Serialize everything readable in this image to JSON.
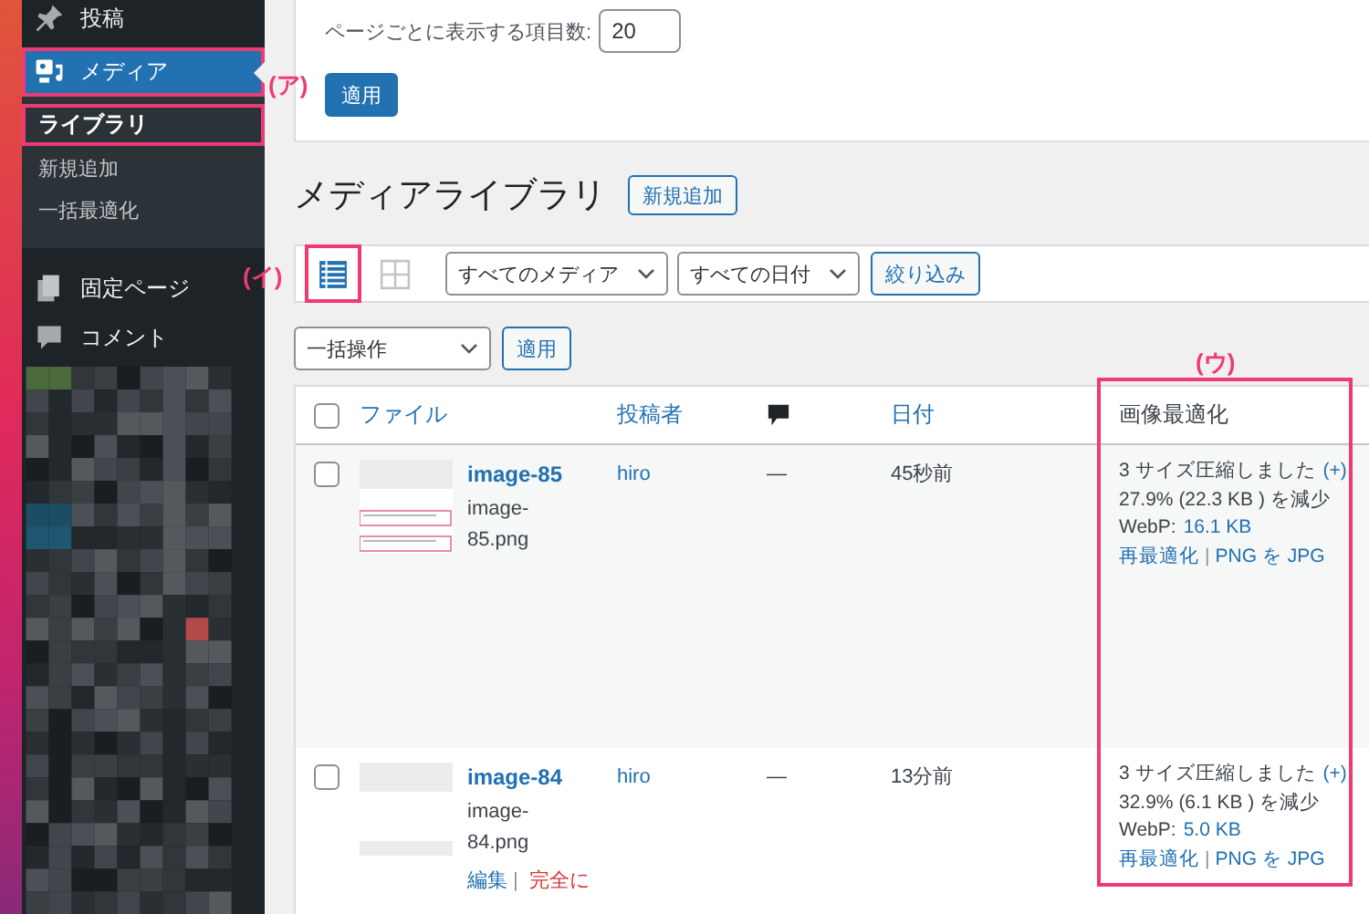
{
  "sidebar": {
    "items": [
      {
        "label": "投稿",
        "selected": false,
        "highlighted": false
      },
      {
        "label": "メディア",
        "selected": true,
        "highlighted": true,
        "children": [
          {
            "label": "ライブラリ",
            "selected": true,
            "highlighted": true
          },
          {
            "label": "新規追加",
            "selected": false,
            "highlighted": false
          },
          {
            "label": "一括最適化",
            "selected": false,
            "highlighted": false
          }
        ]
      },
      {
        "label": "固定ページ",
        "selected": false,
        "highlighted": false
      },
      {
        "label": "コメント",
        "selected": false,
        "highlighted": false
      }
    ],
    "hidden_area": {
      "kind": "picture"
    }
  },
  "annotations": [
    {
      "label": "(ア)"
    },
    {
      "label": "(イ)"
    },
    {
      "label": "(ウ)"
    }
  ],
  "screen_options": {
    "per_page_label": "ページごとに表示する項目数:",
    "per_page_value": "20",
    "apply_button": "適用"
  },
  "heading": {
    "title": "メディアライブラリ",
    "add_new_button": "新規追加"
  },
  "filters": {
    "view_modes": [
      {
        "kind": "list",
        "selected": true,
        "highlighted": true
      },
      {
        "kind": "grid",
        "selected": false,
        "highlighted": false
      }
    ],
    "media_select": "すべてのメディア",
    "date_select": "すべての日付",
    "filter_button": "絞り込み"
  },
  "bulk_actions": {
    "select": "一括操作",
    "apply_button": "適用"
  },
  "table": {
    "select_all_checked": false,
    "columns": [
      {
        "kind": "text",
        "label": "ファイル"
      },
      {
        "kind": "text",
        "label": "投稿者"
      },
      {
        "kind": "comments"
      },
      {
        "kind": "text",
        "label": "日付"
      },
      {
        "kind": "plain",
        "label": "画像最適化",
        "highlighted": true
      }
    ],
    "rows": [
      {
        "checked": false,
        "thumbnail": {
          "kind": "picture"
        },
        "title": "image-85",
        "filename": "image-85.png",
        "author": "hiro",
        "comments": "—",
        "date": "45秒前",
        "optimization": {
          "summary": "3 サイズ圧縮しました",
          "details_link": "(+)",
          "reduction": "27.9% (22.3 KB ) を減少",
          "webp_label": "WebP:",
          "webp_size": "16.1 KB",
          "reoptimize_link": "再最適化",
          "link_separator": "|",
          "convert_link": "PNG を JPG"
        }
      },
      {
        "checked": false,
        "thumbnail": {
          "kind": "picture"
        },
        "title": "image-84",
        "filename": "image-84.png",
        "author": "hiro",
        "comments": "—",
        "date": "13分前",
        "actions": [
          {
            "kind": "edit",
            "label": "編集"
          },
          {
            "kind": "delete",
            "label": "完全に"
          }
        ],
        "action_separator": "|",
        "optimization": {
          "summary": "3 サイズ圧縮しました",
          "details_link": "(+)",
          "reduction": "32.9% (6.1 KB ) を減少",
          "webp_label": "WebP:",
          "webp_size": "5.0 KB",
          "reoptimize_link": "再最適化",
          "link_separator": "|",
          "convert_link": "PNG を JPG"
        }
      }
    ]
  }
}
